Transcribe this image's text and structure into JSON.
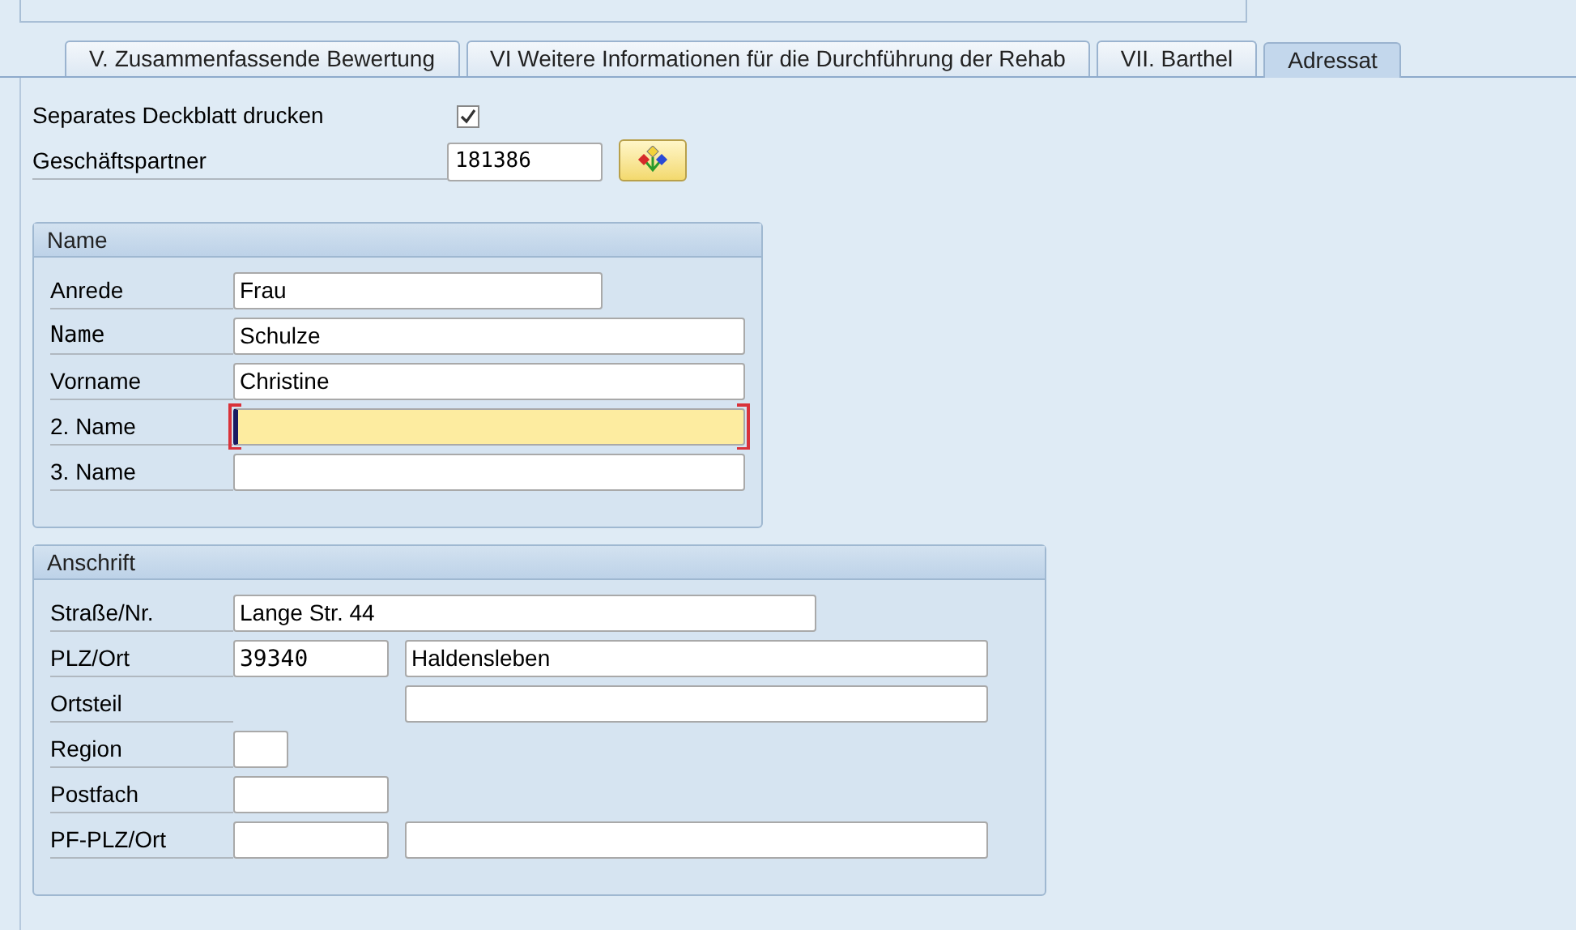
{
  "tabs": [
    {
      "label": "V. Zusammenfassende Bewertung",
      "selected": false
    },
    {
      "label": "VI Weitere Informationen für die Durchführung der Rehab",
      "selected": false
    },
    {
      "label": "VII. Barthel",
      "selected": false
    },
    {
      "label": "Adressat",
      "selected": true
    }
  ],
  "print_cover": {
    "label": "Separates Deckblatt drucken",
    "checked": true
  },
  "business_partner": {
    "label": "Geschäftspartner",
    "value": "181386"
  },
  "name_group": {
    "title": "Name",
    "rows": [
      {
        "label": "Anrede",
        "fields": [
          {
            "value": "Frau",
            "focused": false
          }
        ]
      },
      {
        "label": "Name",
        "fields": [
          {
            "value": "Schulze",
            "focused": false
          }
        ]
      },
      {
        "label": "Vorname",
        "fields": [
          {
            "value": "Christine",
            "focused": false
          }
        ]
      },
      {
        "label": "2. Name",
        "fields": [
          {
            "focused": true
          }
        ]
      },
      {
        "label": "3. Name",
        "fields": [
          {
            "focused": false
          }
        ]
      }
    ]
  },
  "address_group": {
    "title": "Anschrift",
    "rows": [
      {
        "label": "Straße/Nr.",
        "fields": [
          {
            "value": "Lange Str. 44",
            "focused": false
          }
        ]
      },
      {
        "label": "PLZ/Ort",
        "fields": [
          {
            "value": "39340",
            "focused": false
          },
          {
            "value": "Haldensleben",
            "focused": false
          }
        ]
      },
      {
        "label": "Ortsteil",
        "fields": [
          {
            "focused": false
          }
        ]
      },
      {
        "label": "Region",
        "fields": [
          {
            "focused": false
          }
        ]
      },
      {
        "label": "Postfach",
        "fields": [
          {
            "focused": false
          }
        ]
      },
      {
        "label": "PF-PLZ/Ort",
        "fields": [
          {
            "focused": false
          },
          {
            "focused": false
          }
        ]
      }
    ]
  }
}
